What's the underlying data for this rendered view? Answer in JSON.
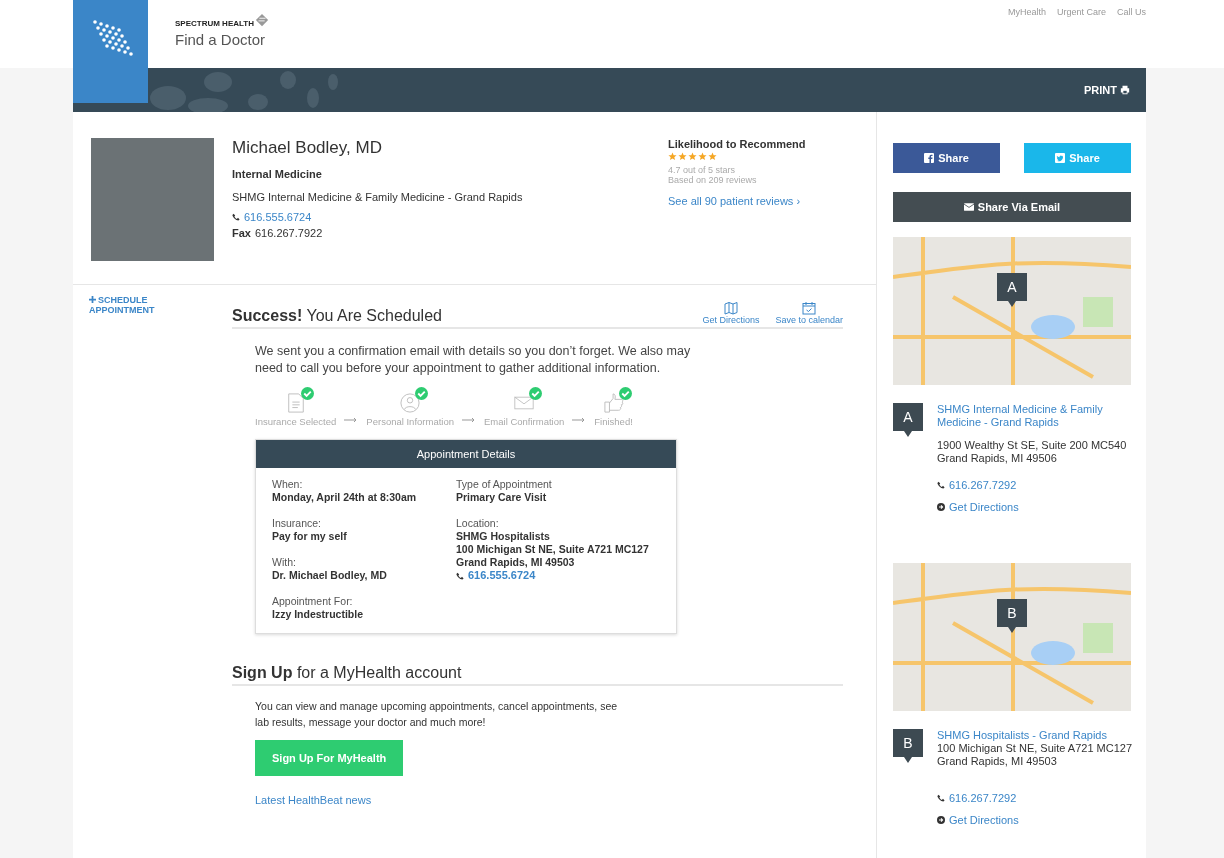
{
  "header": {
    "brand": "SPECTRUM HEALTH",
    "subtitle": "Find a Doctor",
    "links": [
      "MyHealth",
      "Urgent Care",
      "Call Us"
    ],
    "print": "PRINT"
  },
  "doctor": {
    "name": "Michael Bodley, MD",
    "specialty": "Internal Medicine",
    "practice": "SHMG Internal Medicine & Family Medicine - Grand Rapids",
    "phone": "616.555.6724",
    "fax_label": "Fax",
    "fax": "616.267.7922"
  },
  "rating": {
    "title": "Likelihood to Recommend",
    "stars": 5,
    "score": "4.7 out of 5 stars",
    "based_on": "Based on 209 reviews",
    "link": "See all 90 patient reviews ›"
  },
  "schedule_link": "SCHEDULE APPOINTMENT",
  "success": {
    "heading": "**Success!** You Are Scheduled",
    "actions": [
      {
        "kind": "map",
        "label": "Get Directions"
      },
      {
        "kind": "calendar",
        "label": "Save to calendar"
      }
    ],
    "message": "We sent you a confirmation email with details so you don’t forget. We also may need to call you before your appointment to gather additional information.",
    "steps": [
      {
        "kind": "document",
        "label": "Insurance Selected",
        "done": true
      },
      {
        "kind": "person",
        "label": "Personal Information",
        "done": true
      },
      {
        "kind": "envelope",
        "label": "Email Confirmation",
        "done": true
      },
      {
        "kind": "thumbs",
        "label": "Finished!",
        "done": true
      }
    ]
  },
  "appointment": {
    "title": "Appointment Details",
    "left": [
      {
        "label": "When:",
        "lines": [
          "Monday, April 24th at 8:30am"
        ]
      },
      {
        "label": "Insurance:",
        "lines": [
          "Pay for my self"
        ]
      },
      {
        "label": "With:",
        "lines": [
          "Dr. Michael Bodley, MD"
        ]
      },
      {
        "label": "Appointment For:",
        "lines": [
          "Izzy Indestructible"
        ]
      }
    ],
    "right": [
      {
        "label": "Type of Appointment",
        "lines": [
          "Primary Care Visit"
        ]
      },
      {
        "label": "Location:",
        "lines": [
          "SHMG Hospitalists",
          "100 Michigan St NE, Suite A721 MC127",
          "Grand Rapids, MI 49503"
        ],
        "phone": "616.555.6724"
      }
    ]
  },
  "signup": {
    "heading": "**Sign Up** for a MyHealth account",
    "text": "You can view and manage upcoming appointments, cancel appointments, see lab results, message your doctor and much more!",
    "button": "Sign Up For MyHealth",
    "news_link": "Latest HealthBeat news"
  },
  "share": [
    {
      "kind": "facebook",
      "label": "Share"
    },
    {
      "kind": "twitter",
      "label": "Share"
    },
    {
      "kind": "email",
      "label": "Share Via Email"
    }
  ],
  "locations": [
    {
      "map_pin": "A",
      "pin": "A",
      "name": "SHMG Internal Medicine & Family Medicine - Grand Rapids",
      "address": [
        "1900 Wealthy St SE, Suite 200 MC540",
        "Grand Rapids, MI 49506"
      ],
      "phone": "616.267.7292",
      "directions": "Get Directions"
    },
    {
      "map_pin": "B",
      "pin": "B",
      "name": "SHMG Hospitalists - Grand Rapids",
      "address": [
        "100 Michigan St NE, Suite A721 MC127",
        "Grand Rapids, MI 49503"
      ],
      "phone": "616.267.7292",
      "directions": "Get Directions"
    }
  ]
}
